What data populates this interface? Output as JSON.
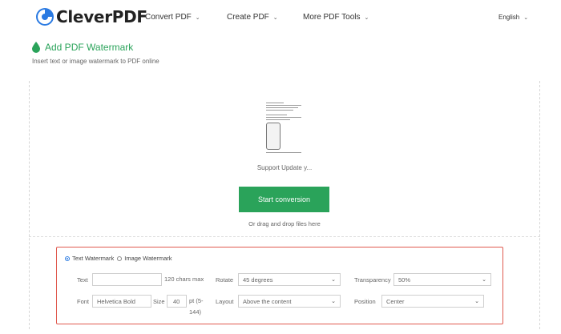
{
  "header": {
    "brand": "CleverPDF",
    "nav": [
      {
        "label": "Convert PDF"
      },
      {
        "label": "Create PDF"
      },
      {
        "label": "More PDF Tools"
      }
    ],
    "language": "English"
  },
  "tool": {
    "title": "Add PDF Watermark",
    "subtitle": "Insert text or image watermark to PDF online"
  },
  "upload": {
    "file_name": "Support Update y...",
    "start_button": "Start conversion",
    "drag_hint": "Or drag and drop files here"
  },
  "options": {
    "watermark_types": [
      {
        "label": "Text Watermark",
        "selected": true
      },
      {
        "label": "Image Watermark",
        "selected": false
      }
    ],
    "text": {
      "label": "Text",
      "value": "",
      "note": "120 chars max"
    },
    "rotate": {
      "label": "Rotate",
      "value": "45 degrees"
    },
    "transparency": {
      "label": "Transparency",
      "value": "50%"
    },
    "font": {
      "label": "Font",
      "value": "Helvetica Bold"
    },
    "size": {
      "label": "Size",
      "value": "40",
      "unit_line1": "pt (5-",
      "unit_line2": "144)"
    },
    "layout": {
      "label": "Layout",
      "value": "Above the content"
    },
    "position": {
      "label": "Position",
      "value": "Center"
    }
  },
  "colors": {
    "accent_green": "#2aa35a",
    "highlight_red": "#e05a4f",
    "logo_blue": "#2a7ae2"
  }
}
